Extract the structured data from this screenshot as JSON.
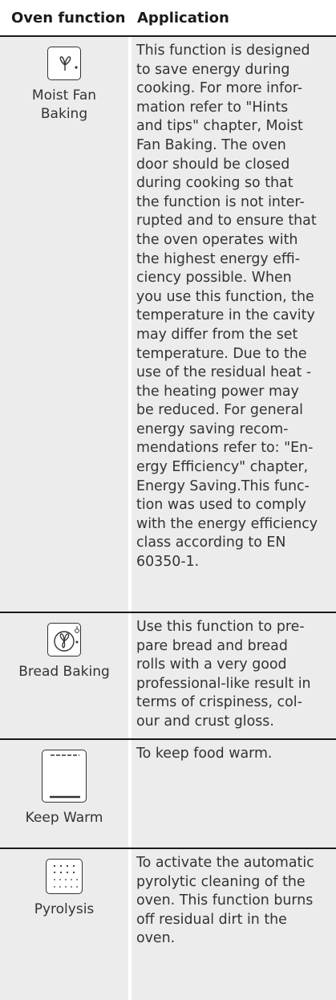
{
  "header": {
    "col_function": "Oven function",
    "col_application": "Application"
  },
  "rows": [
    {
      "name": "Moist Fan Baking",
      "icon": "moist-fan-icon",
      "lines": [
        "This function is designed",
        "to save energy during",
        "cooking. For more infor-",
        "mation refer to \"Hints",
        "and tips\" chapter, Moist",
        "Fan Baking. The oven",
        "door should be closed",
        "during cooking so that",
        "the function is not inter-",
        "rupted and to ensure that",
        "the oven operates with",
        "the highest energy effi-",
        "ciency possible. When",
        "you use this function, the",
        "temperature in the cavity",
        "may differ from the set",
        "temperature. Due to the",
        "use of the residual heat -",
        "the heating power may",
        "be reduced. For general",
        "energy saving recom-",
        "mendations refer to: \"En-",
        "ergy Efficiency\" chapter,",
        "Energy Saving.This func-",
        "tion was used to comply",
        "with the energy efficiency",
        "class according to EN",
        "60350-1."
      ]
    },
    {
      "name": "Bread Baking",
      "icon": "bread-baking-icon",
      "lines": [
        "Use this function to pre-",
        "pare bread and bread",
        "rolls with a very good",
        "professional-like result in",
        "terms of crispiness, col-",
        "our and crust gloss."
      ]
    },
    {
      "name": "Keep Warm",
      "icon": "keep-warm-icon",
      "lines": [
        "To keep food warm."
      ]
    },
    {
      "name": "Pyrolysis",
      "icon": "pyrolysis-icon",
      "lines": [
        "To activate the automatic",
        "pyrolytic cleaning of the",
        "oven. This function burns",
        "off residual dirt in the",
        "oven."
      ]
    }
  ]
}
